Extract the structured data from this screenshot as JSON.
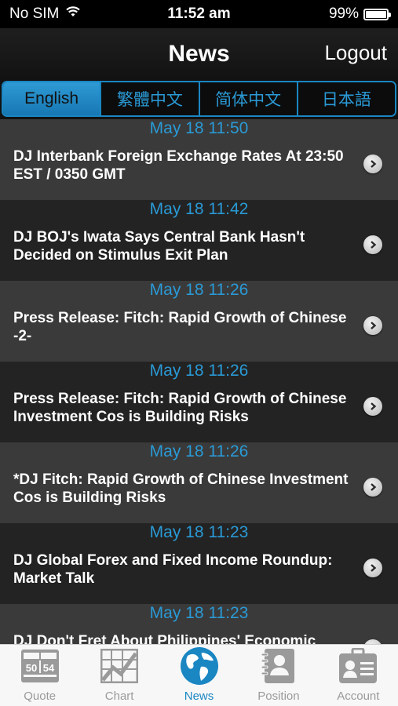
{
  "status_bar": {
    "carrier": "No SIM",
    "time": "11:52 am",
    "battery": "99%",
    "battery_level": 0.99
  },
  "nav": {
    "title": "News",
    "logout_label": "Logout"
  },
  "languages": [
    {
      "label": "English",
      "active": true
    },
    {
      "label": "繁體中文",
      "active": false
    },
    {
      "label": "简体中文",
      "active": false
    },
    {
      "label": "日本語",
      "active": false
    }
  ],
  "news": [
    {
      "time": "May 18 11:50",
      "headline": "DJ Interbank Foreign Exchange Rates At 23:50 EST / 0350 GMT"
    },
    {
      "time": "May 18 11:42",
      "headline": "DJ BOJ's Iwata Says Central Bank Hasn't Decided on Stimulus Exit Plan"
    },
    {
      "time": "May 18 11:26",
      "headline": "Press Release: Fitch: Rapid Growth of Chinese -2-"
    },
    {
      "time": "May 18 11:26",
      "headline": "Press Release: Fitch: Rapid Growth of Chinese Investment Cos is Building Risks"
    },
    {
      "time": "May 18 11:26",
      "headline": "*DJ Fitch: Rapid Growth of Chinese Investment Cos is Building Risks"
    },
    {
      "time": "May 18 11:23",
      "headline": "DJ Global Forex and Fixed Income Roundup: Market Talk"
    },
    {
      "time": "May 18 11:23",
      "headline": "DJ Don't Fret About Philippines' Economic"
    }
  ],
  "tabs": [
    {
      "label": "Quote",
      "icon": "quote-board-icon",
      "active": false
    },
    {
      "label": "Chart",
      "icon": "chart-icon",
      "active": false
    },
    {
      "label": "News",
      "icon": "globe-icon",
      "active": true
    },
    {
      "label": "Position",
      "icon": "position-notebook-icon",
      "active": false
    },
    {
      "label": "Account",
      "icon": "account-id-card-icon",
      "active": false
    }
  ],
  "colors": {
    "accent": "#1a86c2",
    "tab_inactive": "#9a9a9a",
    "row_light": "#3a3a3a",
    "row_dark": "#232323"
  }
}
